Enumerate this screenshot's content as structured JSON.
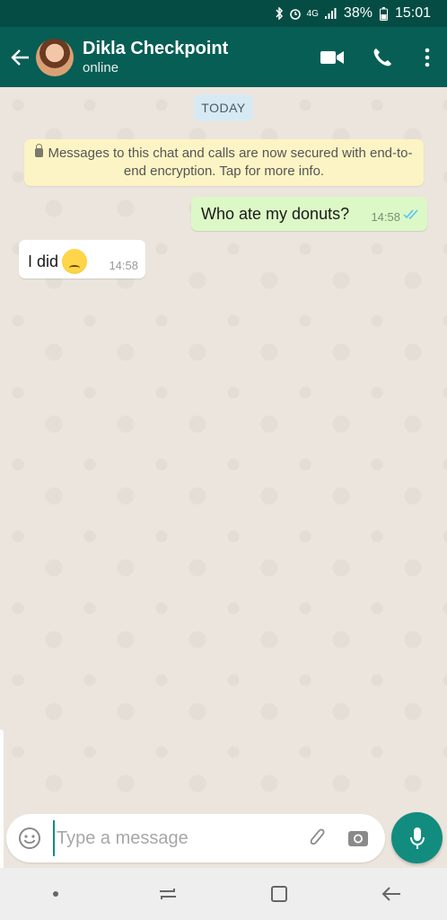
{
  "status": {
    "battery": "38%",
    "time": "15:01",
    "network": "4G"
  },
  "header": {
    "contact_name": "Dikla Checkpoint",
    "presence": "online"
  },
  "chat": {
    "date_label": "TODAY",
    "encryption_notice": "Messages to this chat and calls are now secured with end-to-end encryption. Tap for more info.",
    "messages": [
      {
        "direction": "outgoing",
        "text": "Who ate my donuts?",
        "time": "14:58",
        "status": "read"
      },
      {
        "direction": "incoming",
        "text": "I did",
        "time": "14:58",
        "emoji": "downcast-sweat-face"
      }
    ]
  },
  "composer": {
    "placeholder": "Type a message"
  },
  "colors": {
    "header": "#075e54",
    "accent": "#128c7e",
    "outgoing_bubble": "#dcf8c6",
    "background": "#ece5dd"
  }
}
